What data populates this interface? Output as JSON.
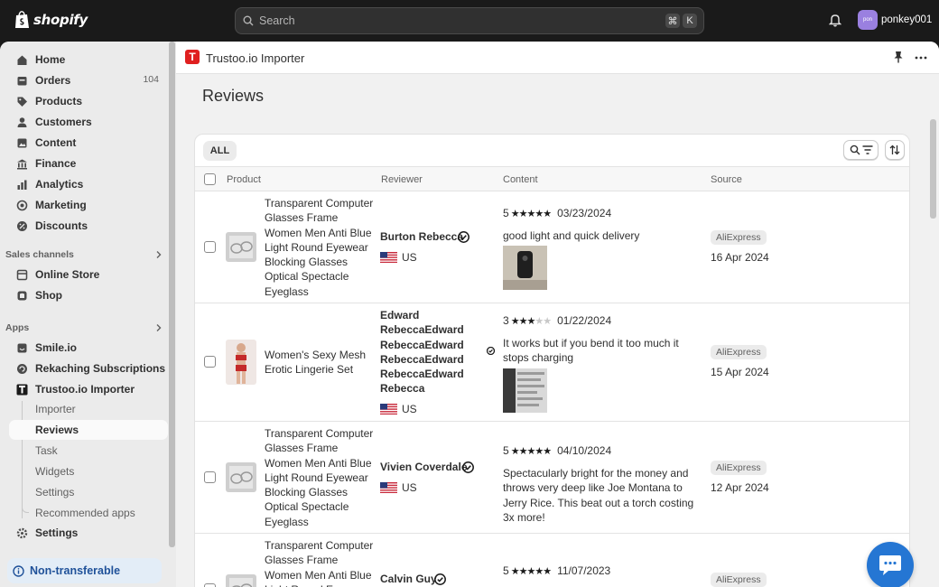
{
  "topbar": {
    "brand": "shopify",
    "search_placeholder": "Search",
    "shortcut_key1": "⌘",
    "shortcut_key2": "K",
    "avatar_initials": "pon",
    "username": "ponkey001"
  },
  "sidebar": {
    "items": [
      {
        "label": "Home",
        "icon": "home-icon"
      },
      {
        "label": "Orders",
        "icon": "orders-icon",
        "badge": "104"
      },
      {
        "label": "Products",
        "icon": "tag-icon"
      },
      {
        "label": "Customers",
        "icon": "person-icon"
      },
      {
        "label": "Content",
        "icon": "content-icon"
      },
      {
        "label": "Finance",
        "icon": "bank-icon"
      },
      {
        "label": "Analytics",
        "icon": "analytics-icon"
      },
      {
        "label": "Marketing",
        "icon": "target-icon"
      },
      {
        "label": "Discounts",
        "icon": "discount-icon"
      }
    ],
    "sales_channels_label": "Sales channels",
    "sales_channels": [
      {
        "label": "Online Store",
        "icon": "store-icon"
      },
      {
        "label": "Shop",
        "icon": "shop-icon"
      }
    ],
    "apps_label": "Apps",
    "apps": [
      {
        "label": "Smile.io",
        "icon": "smile-icon"
      },
      {
        "label": "Rekaching Subscriptions",
        "icon": "refresh-icon"
      },
      {
        "label": "Trustoo.io Importer",
        "icon": "trustoo-icon"
      }
    ],
    "app_subitems": [
      "Importer",
      "Reviews",
      "Task",
      "Widgets",
      "Settings",
      "Recommended apps"
    ],
    "settings_label": "Settings",
    "non_transferable": "Non-transferable"
  },
  "app": {
    "logo_letter": "T",
    "title": "Trustoo.io Importer",
    "page_title": "Reviews"
  },
  "table": {
    "tab_all": "ALL",
    "columns": {
      "product": "Product",
      "reviewer": "Reviewer",
      "content": "Content",
      "source": "Source"
    },
    "rows": [
      {
        "product": "Transparent Computer Glasses Frame Women Men Anti Blue Light Round Eyewear Blocking Glasses Optical Spectacle Eyeglass",
        "reviewer": "Burton Rebecca",
        "country": "US",
        "rating": 5,
        "rating_label": "5",
        "review_date": "03/23/2024",
        "content": "good light and quick delivery",
        "source": "AliExpress",
        "imported": "16 Apr 2024"
      },
      {
        "product": "Women's Sexy Mesh Erotic Lingerie Set",
        "reviewer": "Edward RebeccaEdward RebeccaEdward RebeccaEdward RebeccaEdward Rebecca",
        "country": "US",
        "rating": 3,
        "rating_label": "3",
        "review_date": "01/22/2024",
        "content": "It works but if you bend it too much it stops charging",
        "source": "AliExpress",
        "imported": "15 Apr 2024"
      },
      {
        "product": "Transparent Computer Glasses Frame Women Men Anti Blue Light Round Eyewear Blocking Glasses Optical Spectacle Eyeglass",
        "reviewer": "Vivien Coverdale",
        "country": "US",
        "rating": 5,
        "rating_label": "5",
        "review_date": "04/10/2024",
        "content": "Spectacularly bright for the money and throws very deep like Joe Montana to Jerry Rice. This beat out a torch costing 3x more!",
        "source": "AliExpress",
        "imported": "12 Apr 2024"
      },
      {
        "product": "Transparent Computer Glasses Frame Women Men Anti Blue Light Round Eyewear",
        "reviewer": "Calvin Guy",
        "country": "",
        "rating": 5,
        "rating_label": "5",
        "review_date": "11/07/2023",
        "content": "",
        "source": "AliExpress",
        "imported": ""
      }
    ]
  },
  "colors": {
    "topbar": "#1a1a1a",
    "accent_blue": "#2576d3",
    "logo_red": "#e02020",
    "frame": "#ebebeb"
  }
}
